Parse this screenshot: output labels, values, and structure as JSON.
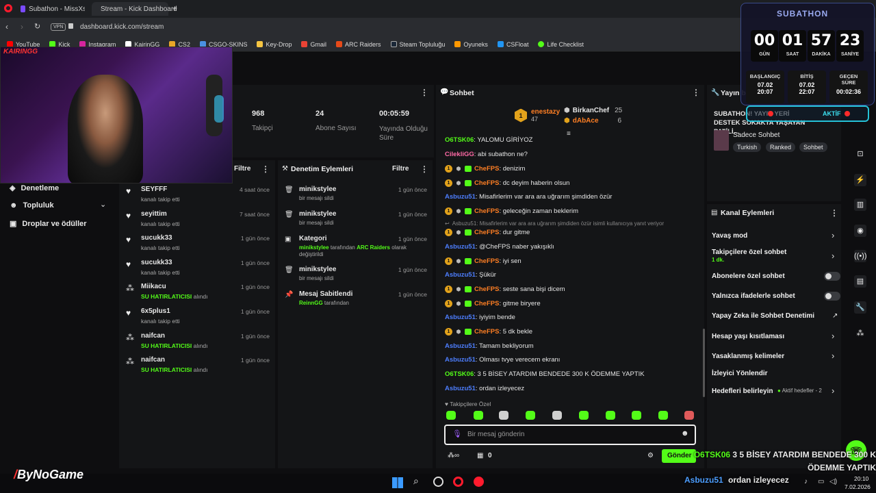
{
  "browser": {
    "tabs": [
      {
        "label": "Subathon - MissXss AI Bo"
      },
      {
        "label": "Stream - Kick Dashboard"
      }
    ],
    "new_tab": "+",
    "vpn": "VPN",
    "url": "dashboard.kick.com/stream",
    "bookmarks": [
      "YouTube",
      "Kick",
      "Instagram",
      "KairinGG",
      "CS2",
      "CSGO-SKINS",
      "Key-Drop",
      "Gmail",
      "ARC Raiders",
      "Steam Topluluğu",
      "Oyuneks",
      "CSFloat",
      "Life Checklist"
    ]
  },
  "webcam": {
    "tag": "KAIRINGG"
  },
  "sidebar": {
    "items": [
      {
        "label": "Denetleme"
      },
      {
        "label": "Topluluk"
      },
      {
        "label": "Droplar ve ödüller"
      }
    ]
  },
  "stats": [
    {
      "value": "968",
      "label": "Takipçi"
    },
    {
      "value": "24",
      "label": "Abone Sayısı"
    },
    {
      "value": "00:05:59",
      "label": "Yayında Olduğu Süre"
    }
  ],
  "activity": {
    "filter": "Filtre",
    "items": [
      {
        "user": "SEYFFF",
        "desc": "kanalı takip etti",
        "time": "4 saat önce",
        "icon": "heart-icon"
      },
      {
        "user": "seyittim",
        "desc": "kanalı takip etti",
        "time": "7 saat önce",
        "icon": "heart-icon"
      },
      {
        "user": "sucukk33",
        "desc": "kanalı takip etti",
        "time": "1 gün önce",
        "icon": "heart-icon"
      },
      {
        "user": "sucukk33",
        "desc": "kanalı takip etti",
        "time": "1 gün önce",
        "icon": "heart-icon"
      },
      {
        "user": "Miikacu",
        "desc": "alındı",
        "reward": "SU HATIRLATICISI",
        "time": "1 gün önce",
        "icon": "points-icon"
      },
      {
        "user": "6x5plus1",
        "desc": "kanalı takip etti",
        "time": "1 gün önce",
        "icon": "heart-icon"
      },
      {
        "user": "naifcan",
        "desc": "alındı",
        "reward": "SU HATIRLATICISI",
        "time": "1 gün önce",
        "icon": "points-icon"
      },
      {
        "user": "naifcan",
        "desc": "alındı",
        "reward": "SU HATIRLATICISI",
        "time": "1 gün önce",
        "icon": "points-icon"
      }
    ]
  },
  "moderation": {
    "title": "Denetim Eylemleri",
    "filter": "Filtre",
    "items": [
      {
        "title": "minikstylee",
        "desc": "bir mesajı sildi",
        "time": "1 gün önce",
        "icon": "trash-icon"
      },
      {
        "title": "minikstylee",
        "desc": "bir mesajı sildi",
        "time": "1 gün önce",
        "icon": "trash-icon"
      },
      {
        "title": "Kategori",
        "user": "minikstylee",
        "desc_a": "tarafından",
        "game": "ARC Raiders",
        "desc_b": "olarak",
        "desc_c": "değiştirildi",
        "time": "1 gün önce",
        "icon": "category-icon"
      },
      {
        "title": "minikstylee",
        "desc": "bir mesajı sildi",
        "time": "1 gün önce",
        "icon": "trash-icon"
      },
      {
        "title": "Mesaj Sabitlendi",
        "user": "ReinnGG",
        "desc": "tarafından",
        "time": "1 gün önce",
        "icon": "pin-icon"
      }
    ]
  },
  "chat": {
    "title": "Sohbet",
    "top_gifters": [
      {
        "rank": "1",
        "name": "enestazy",
        "count": "47"
      },
      {
        "name": "BirkanChef",
        "count": "25"
      },
      {
        "name": "dAbAce",
        "count": "6"
      }
    ],
    "messages": [
      {
        "user": "O6TSK06",
        "text": ": YALOMU GİRİYOZ",
        "color": "gr",
        "badges": false
      },
      {
        "user": "CilekliGG",
        "text": ": abi subathon ne?",
        "color": "pk",
        "badges": false
      },
      {
        "user": "CheFPS",
        "text": ": denizim",
        "color": "or",
        "badges": true
      },
      {
        "user": "CheFPS",
        "text": ": dc deyim haberin olsun",
        "color": "or",
        "badges": true
      },
      {
        "user": "Asbuzu51",
        "text": ": Misafirlerim var ara ara uğrarım şimdiden özür",
        "color": "bl",
        "badges": false
      },
      {
        "user": "CheFPS",
        "text": ": geleceğin zaman beklerim",
        "color": "or",
        "badges": true
      },
      {
        "reply": "Asbuzu51: Misafirlerim var ara ara uğrarım şimdiden özür isimli kullanıcıya yanıt veriyor"
      },
      {
        "user": "CheFPS",
        "text": ": dur gitme",
        "color": "or",
        "badges": true
      },
      {
        "user": "Asbuzu51",
        "text": ": @CheFPS naber yakışıklı",
        "color": "bl",
        "badges": false
      },
      {
        "user": "CheFPS",
        "text": ": iyi sen",
        "color": "or",
        "badges": true
      },
      {
        "user": "Asbuzu51",
        "text": ": Şükür",
        "color": "bl",
        "badges": false
      },
      {
        "user": "CheFPS",
        "text": ": seste sana bişi dicem",
        "color": "or",
        "badges": true
      },
      {
        "user": "CheFPS",
        "text": ": gitme biryere",
        "color": "or",
        "badges": true
      },
      {
        "user": "Asbuzu51",
        "text": ": iyiyim bende",
        "color": "bl",
        "badges": false
      },
      {
        "user": "CheFPS",
        "text": ": 5 dk bekle",
        "color": "or",
        "badges": true
      },
      {
        "user": "Asbuzu51",
        "text": ": Tamam bekliyorum",
        "color": "bl",
        "badges": false
      },
      {
        "user": "Asbuzu51",
        "text": ": Olması tvye verecem ekranı",
        "color": "bl",
        "badges": false
      },
      {
        "user": "O6TSK06",
        "text": ": 3 5 BİSEY ATARDIM BENDEDE 300 K ÖDEMME YAPTIK",
        "color": "gr",
        "badges": false
      },
      {
        "user": "Asbuzu51",
        "text": ": ordan izleyecez",
        "color": "bl",
        "badges": false
      }
    ],
    "follower_only": "Takipçilere Özel",
    "input_placeholder": "Bir mesaj gönderin",
    "points": "0",
    "send": "Gönder"
  },
  "stream_info": {
    "title": "Yayın bilgisi",
    "stream_title": "SUBATHON! YAYIN YERİ DESTEK SOKAKTA YAŞAYAN PATİLİ...",
    "category": "Sadece Sohbet",
    "tags": [
      "Turkish",
      "Ranked",
      "Sohbet"
    ]
  },
  "channel_actions": {
    "title": "Kanal Eylemleri",
    "slow_mode": "Yavaş mod",
    "follower_chat": "Takipçilere özel sohbet",
    "follower_chat_sub": "1 dk.",
    "sub_chat": "Abonelere özel sohbet",
    "emote_chat": "Yalnızca ifadelerle sohbet",
    "ai_mod": "Yapay Zeka ile Sohbet Denetimi",
    "age_restrict": "Hesap yaşı kısıtlaması",
    "banned_words": "Yasaklanmış kelimeler",
    "viewers_redirected": "İzleyici Yönlendir",
    "set_goals": "Hedefleri belirleyin",
    "active_goals": "Aktif hedefler - 2"
  },
  "subathon": {
    "title": "SUBATHON",
    "active_label": "AKTİF",
    "units": [
      {
        "value": "00",
        "label": "GÜN"
      },
      {
        "value": "01",
        "label": "SAAT"
      },
      {
        "value": "57",
        "label": "DAKİKA"
      },
      {
        "value": "23",
        "label": "SANİYE"
      }
    ],
    "info": [
      {
        "label": "BAŞLANGIÇ",
        "date": "07.02",
        "time": "20:07"
      },
      {
        "label": "BİTİŞ",
        "date": "07.02",
        "time": "22:07"
      },
      {
        "label": "GEÇEN SÜRE",
        "time": "00:02:36"
      }
    ]
  },
  "overlay": {
    "logo": "ByNoGame",
    "user1": "O6TSK06",
    "msg1": "3 5 BİSEY ATARDIM BENDEDE 300 K ÖDEMME YAPTIK",
    "user2": "Asbuzu51",
    "msg2": "ordan izleyecez"
  },
  "taskbar": {
    "time": "20:10",
    "date": "7.02.2026"
  }
}
